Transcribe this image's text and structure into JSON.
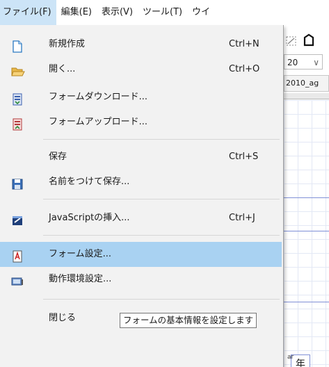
{
  "menubar": {
    "items": [
      {
        "label": "ファイル(F)"
      },
      {
        "label": "編集(E)"
      },
      {
        "label": "表示(V)"
      },
      {
        "label": "ツール(T)"
      },
      {
        "label": "ウイ"
      }
    ]
  },
  "file_menu": {
    "items": [
      {
        "label": "新規作成",
        "shortcut": "Ctrl+N",
        "icon": "new-document-icon"
      },
      {
        "label": "開く...",
        "shortcut": "Ctrl+O",
        "icon": "open-folder-icon"
      },
      {
        "label": "フォームダウンロード...",
        "shortcut": "",
        "icon": "form-download-icon"
      },
      {
        "label": "フォームアップロード...",
        "shortcut": "",
        "icon": "form-upload-icon"
      },
      {
        "label": "保存",
        "shortcut": "Ctrl+S",
        "icon": ""
      },
      {
        "label": "名前をつけて保存...",
        "shortcut": "",
        "icon": "save-as-icon"
      },
      {
        "label": "JavaScriptの挿入...",
        "shortcut": "Ctrl+J",
        "icon": "insert-script-icon"
      },
      {
        "label": "フォーム設定...",
        "shortcut": "",
        "icon": "form-settings-icon",
        "highlighted": true
      },
      {
        "label": "動作環境設定...",
        "shortcut": "",
        "icon": "environment-settings-icon"
      },
      {
        "label": "閉じる",
        "shortcut": "",
        "icon": ""
      }
    ]
  },
  "tooltip": {
    "text": "フォームの基本情報を設定します"
  },
  "background": {
    "zoom_value": "20",
    "zoom_chevron": "∨",
    "file_tab": "2010_ag",
    "cell_small": "ar",
    "cell_text": "年"
  },
  "colors": {
    "menu_bg": "#f2f2f2",
    "highlight": "#a9d2f2",
    "menubar_open": "#cce4f7"
  }
}
